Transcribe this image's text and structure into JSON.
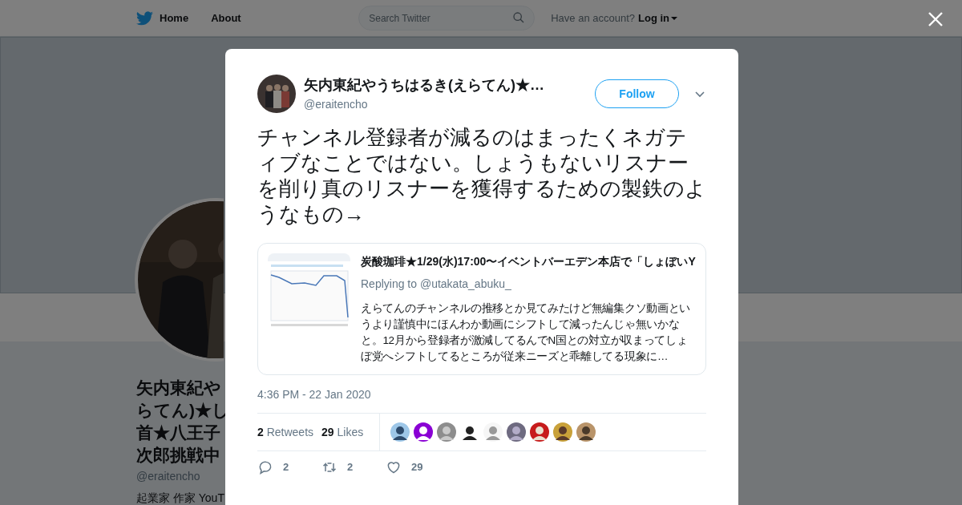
{
  "header": {
    "nav": [
      {
        "label": "Home"
      },
      {
        "label": "About"
      }
    ],
    "search": {
      "placeholder": "Search Twitter"
    },
    "account_prompt": "Have an account?",
    "login": "Log in"
  },
  "profile": {
    "name_lines": [
      "矢内東紀や",
      "らてん)★し",
      "首★八王子",
      "次郎挑戦中"
    ],
    "handle": "@eraitencho",
    "bio": "起業家 作家 YouT"
  },
  "tweet": {
    "author": {
      "name": "矢内東紀やうちはるき(えらてん)★…",
      "handle": "@eraitencho"
    },
    "follow": "Follow",
    "text": "チャンネル登録者が減るのはまったくネガティブなことではない。しょうもないリスナーを削り真のリスナーを獲得するための製鉄のようなもの→",
    "quote": {
      "title": "炭酸珈琲★1/29(水)17:00〜イベントバーエデン本店で「しょぼいY",
      "replying": "Replying to @utakata_abuku_",
      "text": "えらてんのチャンネルの推移とか見てみたけど無編集クソ動画というより謹慎中にほんわか動画にシフトして減ったんじゃ無いかなと。12月から登録者が激減してるんでN国との対立が収まってしょぼ党へシフトしてるところが従来ニーズと乖離してる現象に…"
    },
    "timestamp": "4:36 PM - 22 Jan 2020",
    "stats": [
      {
        "count": "2",
        "label": "Retweets"
      },
      {
        "count": "29",
        "label": "Likes"
      }
    ],
    "actions": [
      {
        "kind": "reply",
        "count": "2"
      },
      {
        "kind": "retweet",
        "count": "2"
      },
      {
        "kind": "like",
        "count": "29"
      }
    ]
  }
}
